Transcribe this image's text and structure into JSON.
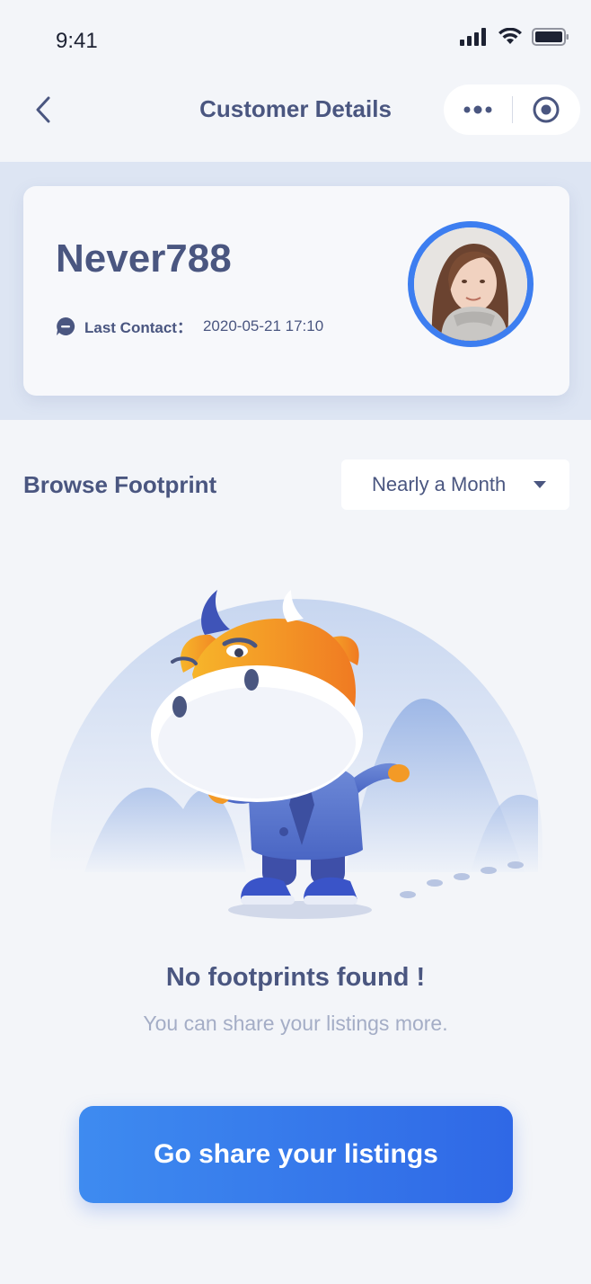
{
  "status_bar": {
    "time": "9:41"
  },
  "navbar": {
    "title": "Customer Details"
  },
  "profile": {
    "name": "Never788",
    "last_contact_label": "Last Contact：",
    "last_contact_value": "2020-05-21 17:10"
  },
  "footprint": {
    "title": "Browse Footprint",
    "filter_value": "Nearly a Month"
  },
  "empty_state": {
    "title": "No footprints found !",
    "subtitle": "You can share your listings more."
  },
  "cta": {
    "label": "Go share your listings"
  },
  "colors": {
    "primary": "#3d7ef0",
    "text": "#4a5680",
    "muted": "#a4adc6",
    "band": "#dde5f3"
  }
}
